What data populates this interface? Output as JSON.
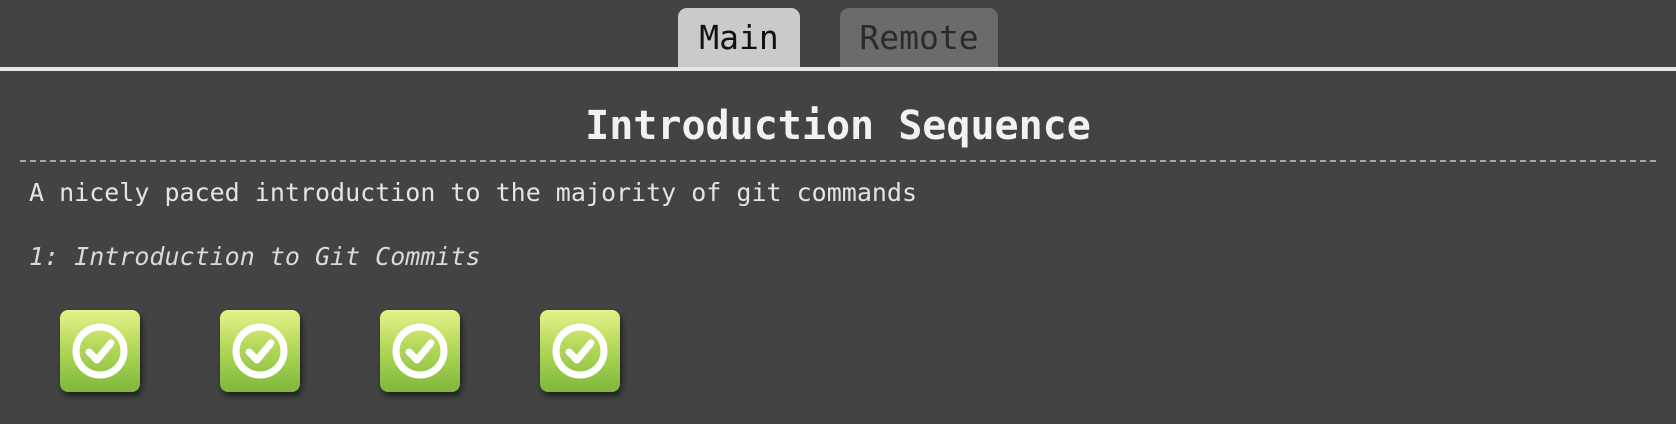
{
  "tabs": [
    {
      "label": "Main",
      "active": true
    },
    {
      "label": "Remote",
      "active": false
    }
  ],
  "sequence": {
    "title": "Introduction Sequence",
    "description": "A nicely paced introduction to the majority of git commands",
    "level_heading": "1: Introduction to Git Commits",
    "levels": [
      {
        "status": "complete",
        "icon": "check-circle-icon"
      },
      {
        "status": "complete",
        "icon": "check-circle-icon"
      },
      {
        "status": "complete",
        "icon": "check-circle-icon"
      },
      {
        "status": "complete",
        "icon": "check-circle-icon"
      }
    ]
  },
  "colors": {
    "background": "#434343",
    "tab_active": "#cacaca",
    "tab_inactive": "#6b6b6b",
    "level_complete": "#9bcb48"
  }
}
